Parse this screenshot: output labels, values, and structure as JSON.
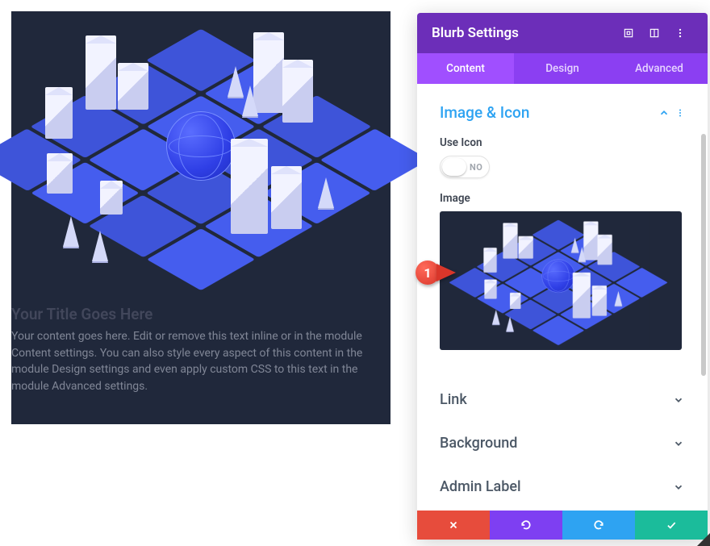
{
  "preview": {
    "title": "Your Title Goes Here",
    "body": "Your content goes here. Edit or remove this text inline or in the module Content settings. You can also style every aspect of this content in the module Design settings and even apply custom CSS to this text in the module Advanced settings."
  },
  "panel": {
    "title": "Blurb Settings",
    "tabs": {
      "content": "Content",
      "design": "Design",
      "advanced": "Advanced"
    },
    "sections": {
      "imageIcon": {
        "title": "Image & Icon"
      },
      "link": {
        "title": "Link"
      },
      "background": {
        "title": "Background"
      },
      "adminLabel": {
        "title": "Admin Label"
      }
    },
    "fields": {
      "useIcon": {
        "label": "Use Icon",
        "value": "NO"
      },
      "image": {
        "label": "Image"
      }
    }
  },
  "callout": {
    "number": "1"
  },
  "colors": {
    "panelHeader": "#6c2eb9",
    "tabsBg": "#8b3ff2",
    "tabActive": "#a04fff",
    "accentBlue": "#2ea3f2",
    "danger": "#e74c3c",
    "success": "#1bbc9b",
    "cardBg": "#20283b"
  }
}
